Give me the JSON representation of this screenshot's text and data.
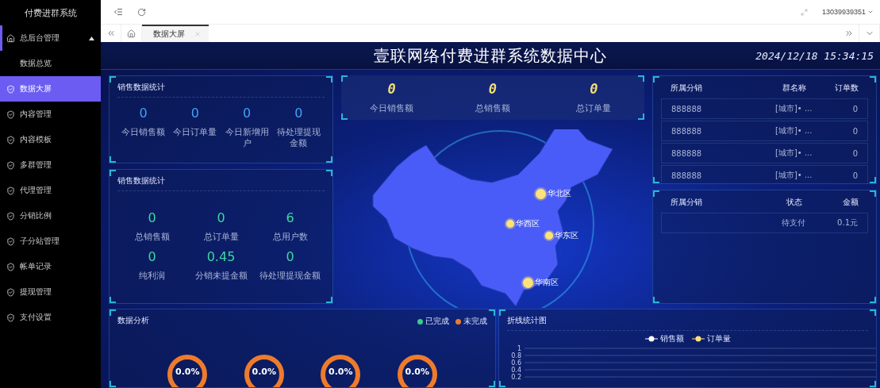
{
  "sidebar": {
    "title": "付费进群系统",
    "items": [
      {
        "label": "总后台管理",
        "kind": "group",
        "expanded": true,
        "selected": false,
        "children": [
          {
            "label": "数据总览",
            "selected": false
          }
        ]
      },
      {
        "label": "数据大屏",
        "kind": "item",
        "selected": true
      },
      {
        "label": "内容管理",
        "kind": "item",
        "selected": false
      },
      {
        "label": "内容模板",
        "kind": "item",
        "selected": false
      },
      {
        "label": "多群管理",
        "kind": "item",
        "selected": false
      },
      {
        "label": "代理管理",
        "kind": "item",
        "selected": false
      },
      {
        "label": "分销比例",
        "kind": "item",
        "selected": false
      },
      {
        "label": "子分站管理",
        "kind": "item",
        "selected": false
      },
      {
        "label": "帐单记录",
        "kind": "item",
        "selected": false
      },
      {
        "label": "提现管理",
        "kind": "item",
        "selected": false
      },
      {
        "label": "支付设置",
        "kind": "item",
        "selected": false
      }
    ]
  },
  "header": {
    "user": "13039939351"
  },
  "tabs": [
    {
      "label": "数据大屏",
      "selected": true
    }
  ],
  "dashboard": {
    "title": "壹联网络付费进群系统数据中心",
    "datetime": "2024/12/18 15:34:15",
    "today_panel": {
      "title": "销售数据统计",
      "stats": [
        {
          "value": "0",
          "label": "今日销售额"
        },
        {
          "value": "0",
          "label": "今日订单量"
        },
        {
          "value": "0",
          "label": "今日新增用户"
        },
        {
          "value": "0",
          "label": "待处理提现金额"
        }
      ]
    },
    "total_panel": {
      "title": "销售数据统计",
      "stats": [
        {
          "value": "0",
          "label": "总销售额"
        },
        {
          "value": "0",
          "label": "总订单量"
        },
        {
          "value": "6",
          "label": "总用户数"
        },
        {
          "value": "0",
          "label": "纯利润"
        },
        {
          "value": "0.45",
          "label": "分销未提金额"
        },
        {
          "value": "0",
          "label": "待处理提现金额"
        }
      ]
    },
    "summary": [
      {
        "value": "0",
        "label": "今日销售额"
      },
      {
        "value": "0",
        "label": "总销售额"
      },
      {
        "value": "0",
        "label": "总订单量"
      }
    ],
    "map": {
      "regions": [
        "华北区",
        "华西区",
        "华东区",
        "华南区"
      ]
    },
    "group_table": {
      "columns": [
        "所属分销",
        "群名称",
        "订单数"
      ],
      "rows": [
        [
          "888888",
          "[城市]• ...",
          "0"
        ],
        [
          "888888",
          "[城市]• ...",
          "0"
        ],
        [
          "888888",
          "[城市]• ...",
          "0"
        ],
        [
          "888888",
          "[城市]• ...",
          "0"
        ]
      ]
    },
    "payment_table": {
      "columns": [
        "所属分销",
        "状态",
        "金额"
      ],
      "rows": [
        {
          "status": "待支付",
          "amount": "0.1元"
        }
      ]
    },
    "analysis": {
      "title": "数据分析",
      "legend": [
        {
          "label": "已完成",
          "color": "#3cc98c"
        },
        {
          "label": "未完成",
          "color": "#ee7b2c"
        }
      ],
      "donuts": [
        {
          "value": "0.0%"
        },
        {
          "value": "0.0%"
        },
        {
          "value": "0.0%"
        },
        {
          "value": "0.0%"
        }
      ]
    },
    "line_chart": {
      "title": "折线统计图",
      "chart_data": {
        "type": "line",
        "series": [
          {
            "name": "销售额",
            "color": "#ffffff"
          },
          {
            "name": "订单量",
            "color": "#ffe27a"
          }
        ],
        "yticks": [
          0.2,
          0.4,
          0.6,
          0.8,
          1
        ],
        "ylim": [
          0.2,
          1
        ],
        "grid": true
      }
    }
  }
}
